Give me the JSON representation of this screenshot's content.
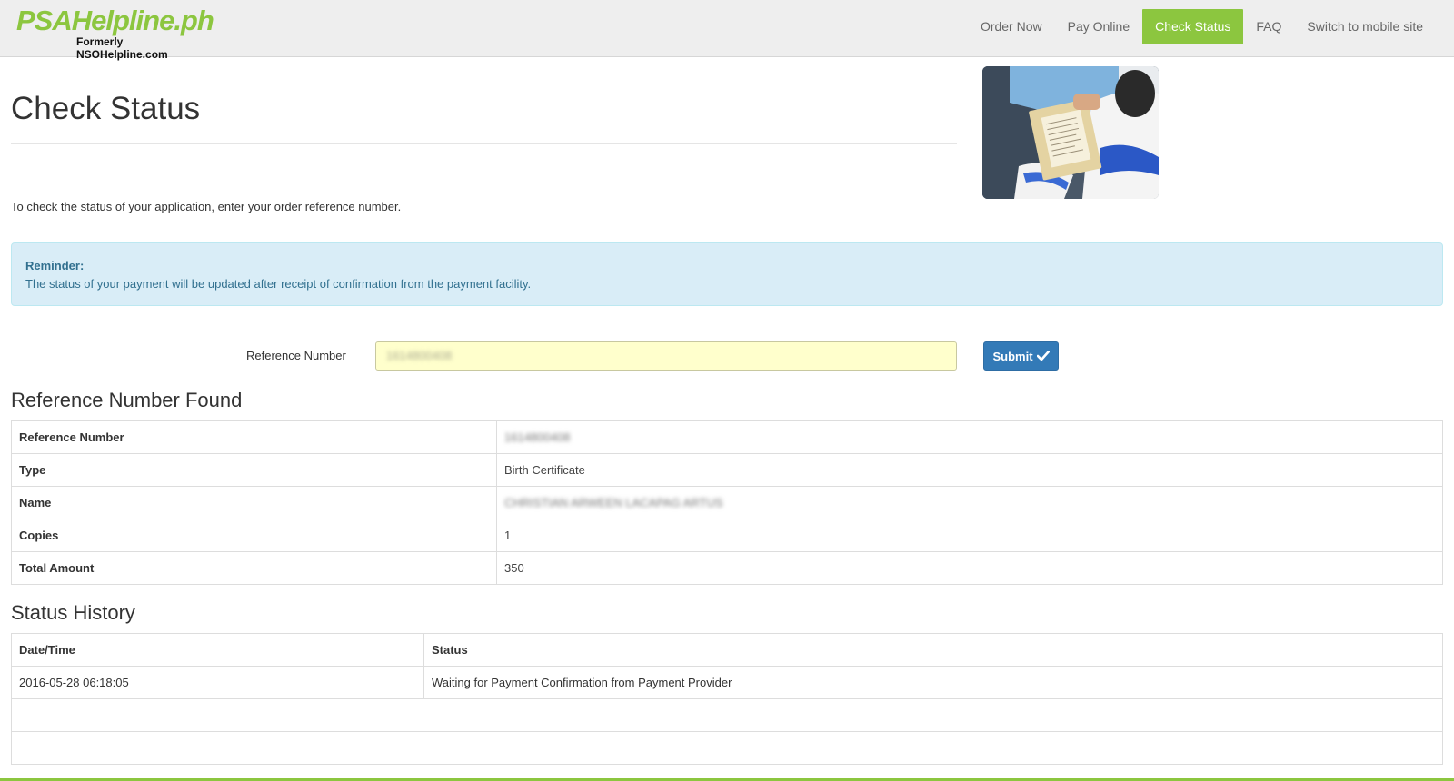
{
  "brand": {
    "title": "PSAHelpline.ph",
    "subtitle": "Formerly NSOHelpline.com",
    "title_color": "#8cc63f"
  },
  "nav": {
    "items": [
      "Order Now",
      "Pay Online",
      "Check Status",
      "FAQ",
      "Switch to mobile site"
    ],
    "active": "Check Status",
    "active_color": "#8cc63f"
  },
  "page": {
    "title": "Check Status",
    "intro": "To check the status of your application, enter your order reference number."
  },
  "alert": {
    "title": "Reminder:",
    "text": "The status of your payment will be updated after receipt of confirmation from the payment facility."
  },
  "form": {
    "label": "Reference Number",
    "value": "1614800408",
    "submit_label": "Submit",
    "submit_color": "#337ab7"
  },
  "found": {
    "title": "Reference Number Found",
    "rows": [
      {
        "key": "Reference Number",
        "value": "1614800408",
        "blurred": true
      },
      {
        "key": "Type",
        "value": "Birth Certificate",
        "blurred": false
      },
      {
        "key": "Name",
        "value": "CHRISTIAN ARWEEN LACAPAG ARTUS",
        "blurred": true
      },
      {
        "key": "Copies",
        "value": "1",
        "blurred": false
      },
      {
        "key": "Total Amount",
        "value": "350",
        "blurred": false
      }
    ]
  },
  "history": {
    "title": "Status History",
    "headers": [
      "Date/Time",
      "Status"
    ],
    "rows": [
      {
        "datetime": "2016-05-28 06:18:05",
        "status": "Waiting for Payment Confirmation from Payment Provider"
      }
    ]
  },
  "icons": {
    "submit": "check-icon",
    "hero": "photo-document-handover"
  }
}
